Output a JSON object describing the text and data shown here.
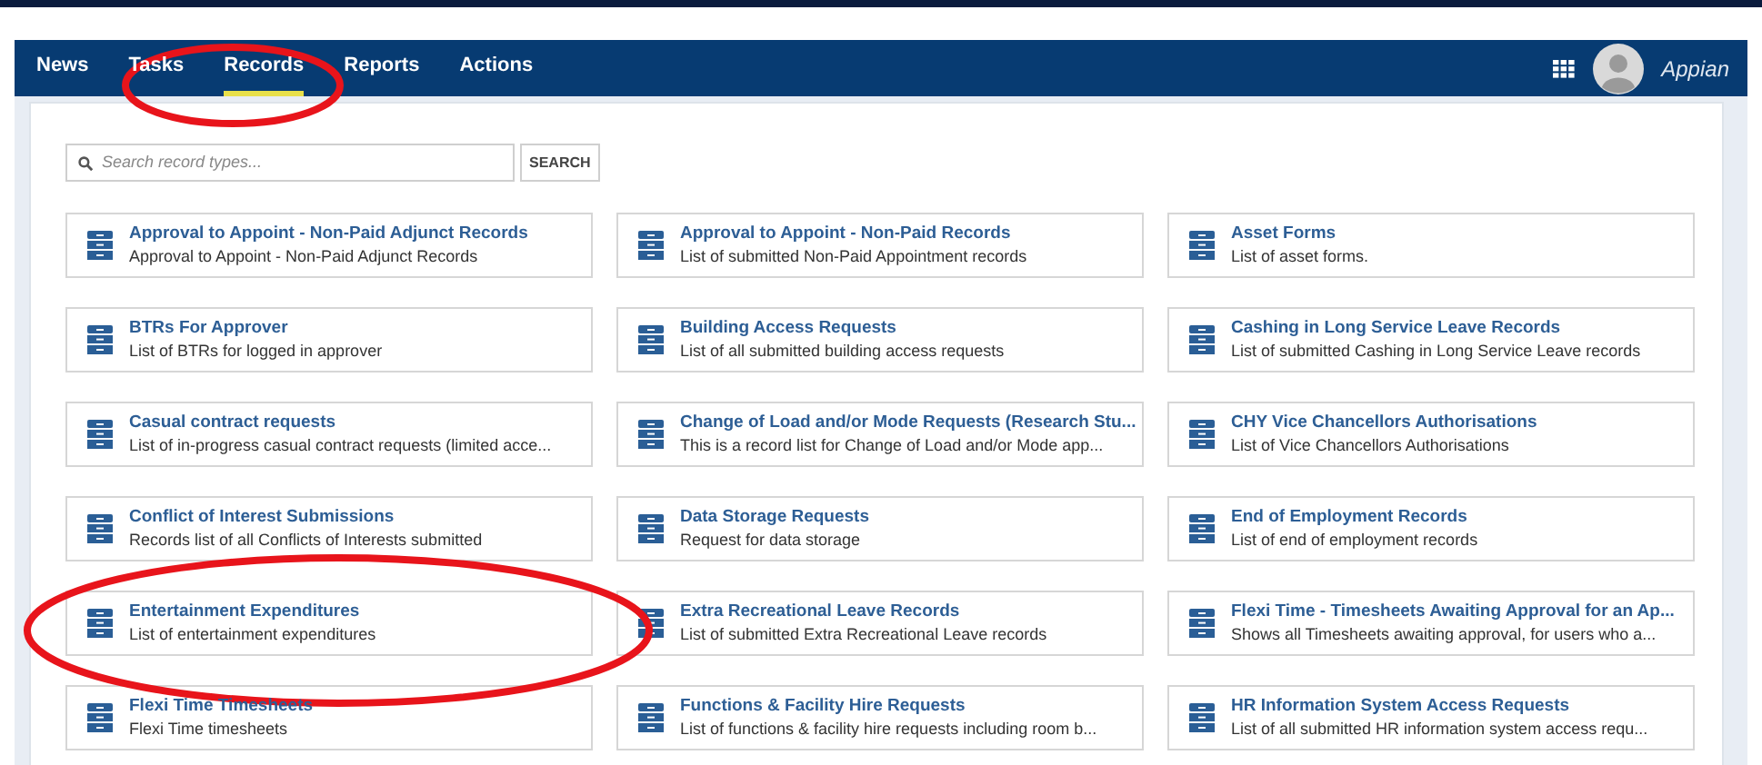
{
  "nav": {
    "tabs": [
      {
        "label": "News",
        "selected": false
      },
      {
        "label": "Tasks",
        "selected": false
      },
      {
        "label": "Records",
        "selected": true
      },
      {
        "label": "Reports",
        "selected": false
      },
      {
        "label": "Actions",
        "selected": false
      }
    ],
    "logo": "Appian"
  },
  "search": {
    "placeholder": "Search record types...",
    "button": "SEARCH"
  },
  "records": [
    {
      "title": "Approval to Appoint - Non-Paid Adjunct Records",
      "description": "Approval to Appoint - Non-Paid Adjunct Records"
    },
    {
      "title": "Approval to Appoint - Non-Paid Records",
      "description": "List of submitted Non-Paid Appointment records"
    },
    {
      "title": "Asset Forms",
      "description": "List of asset forms."
    },
    {
      "title": "BTRs For Approver",
      "description": "List of BTRs for logged in approver"
    },
    {
      "title": "Building Access Requests",
      "description": "List of all submitted building access requests"
    },
    {
      "title": "Cashing in Long Service Leave Records",
      "description": "List of submitted Cashing in Long Service Leave records"
    },
    {
      "title": "Casual contract requests",
      "description": "List of in-progress casual contract requests (limited acce..."
    },
    {
      "title": "Change of Load and/or Mode Requests (Research Stu...",
      "description": "This is a record list for Change of Load and/or Mode app..."
    },
    {
      "title": "CHY Vice Chancellors Authorisations",
      "description": "List of Vice Chancellors Authorisations"
    },
    {
      "title": "Conflict of Interest Submissions",
      "description": "Records list of all Conflicts of Interests submitted"
    },
    {
      "title": "Data Storage Requests",
      "description": "Request for data storage"
    },
    {
      "title": "End of Employment Records",
      "description": "List of end of employment records"
    },
    {
      "title": "Entertainment Expenditures",
      "description": "List of entertainment expenditures"
    },
    {
      "title": "Extra Recreational Leave Records",
      "description": "List of submitted Extra Recreational Leave records"
    },
    {
      "title": "Flexi Time - Timesheets Awaiting Approval for an Ap...",
      "description": "Shows all Timesheets awaiting approval, for users who a..."
    },
    {
      "title": "Flexi Time Timesheets",
      "description": "Flexi Time timesheets"
    },
    {
      "title": "Functions & Facility Hire Requests",
      "description": "List of functions & facility hire requests including room b..."
    },
    {
      "title": "HR Information System Access Requests",
      "description": "List of all submitted HR information system access requ..."
    }
  ]
}
